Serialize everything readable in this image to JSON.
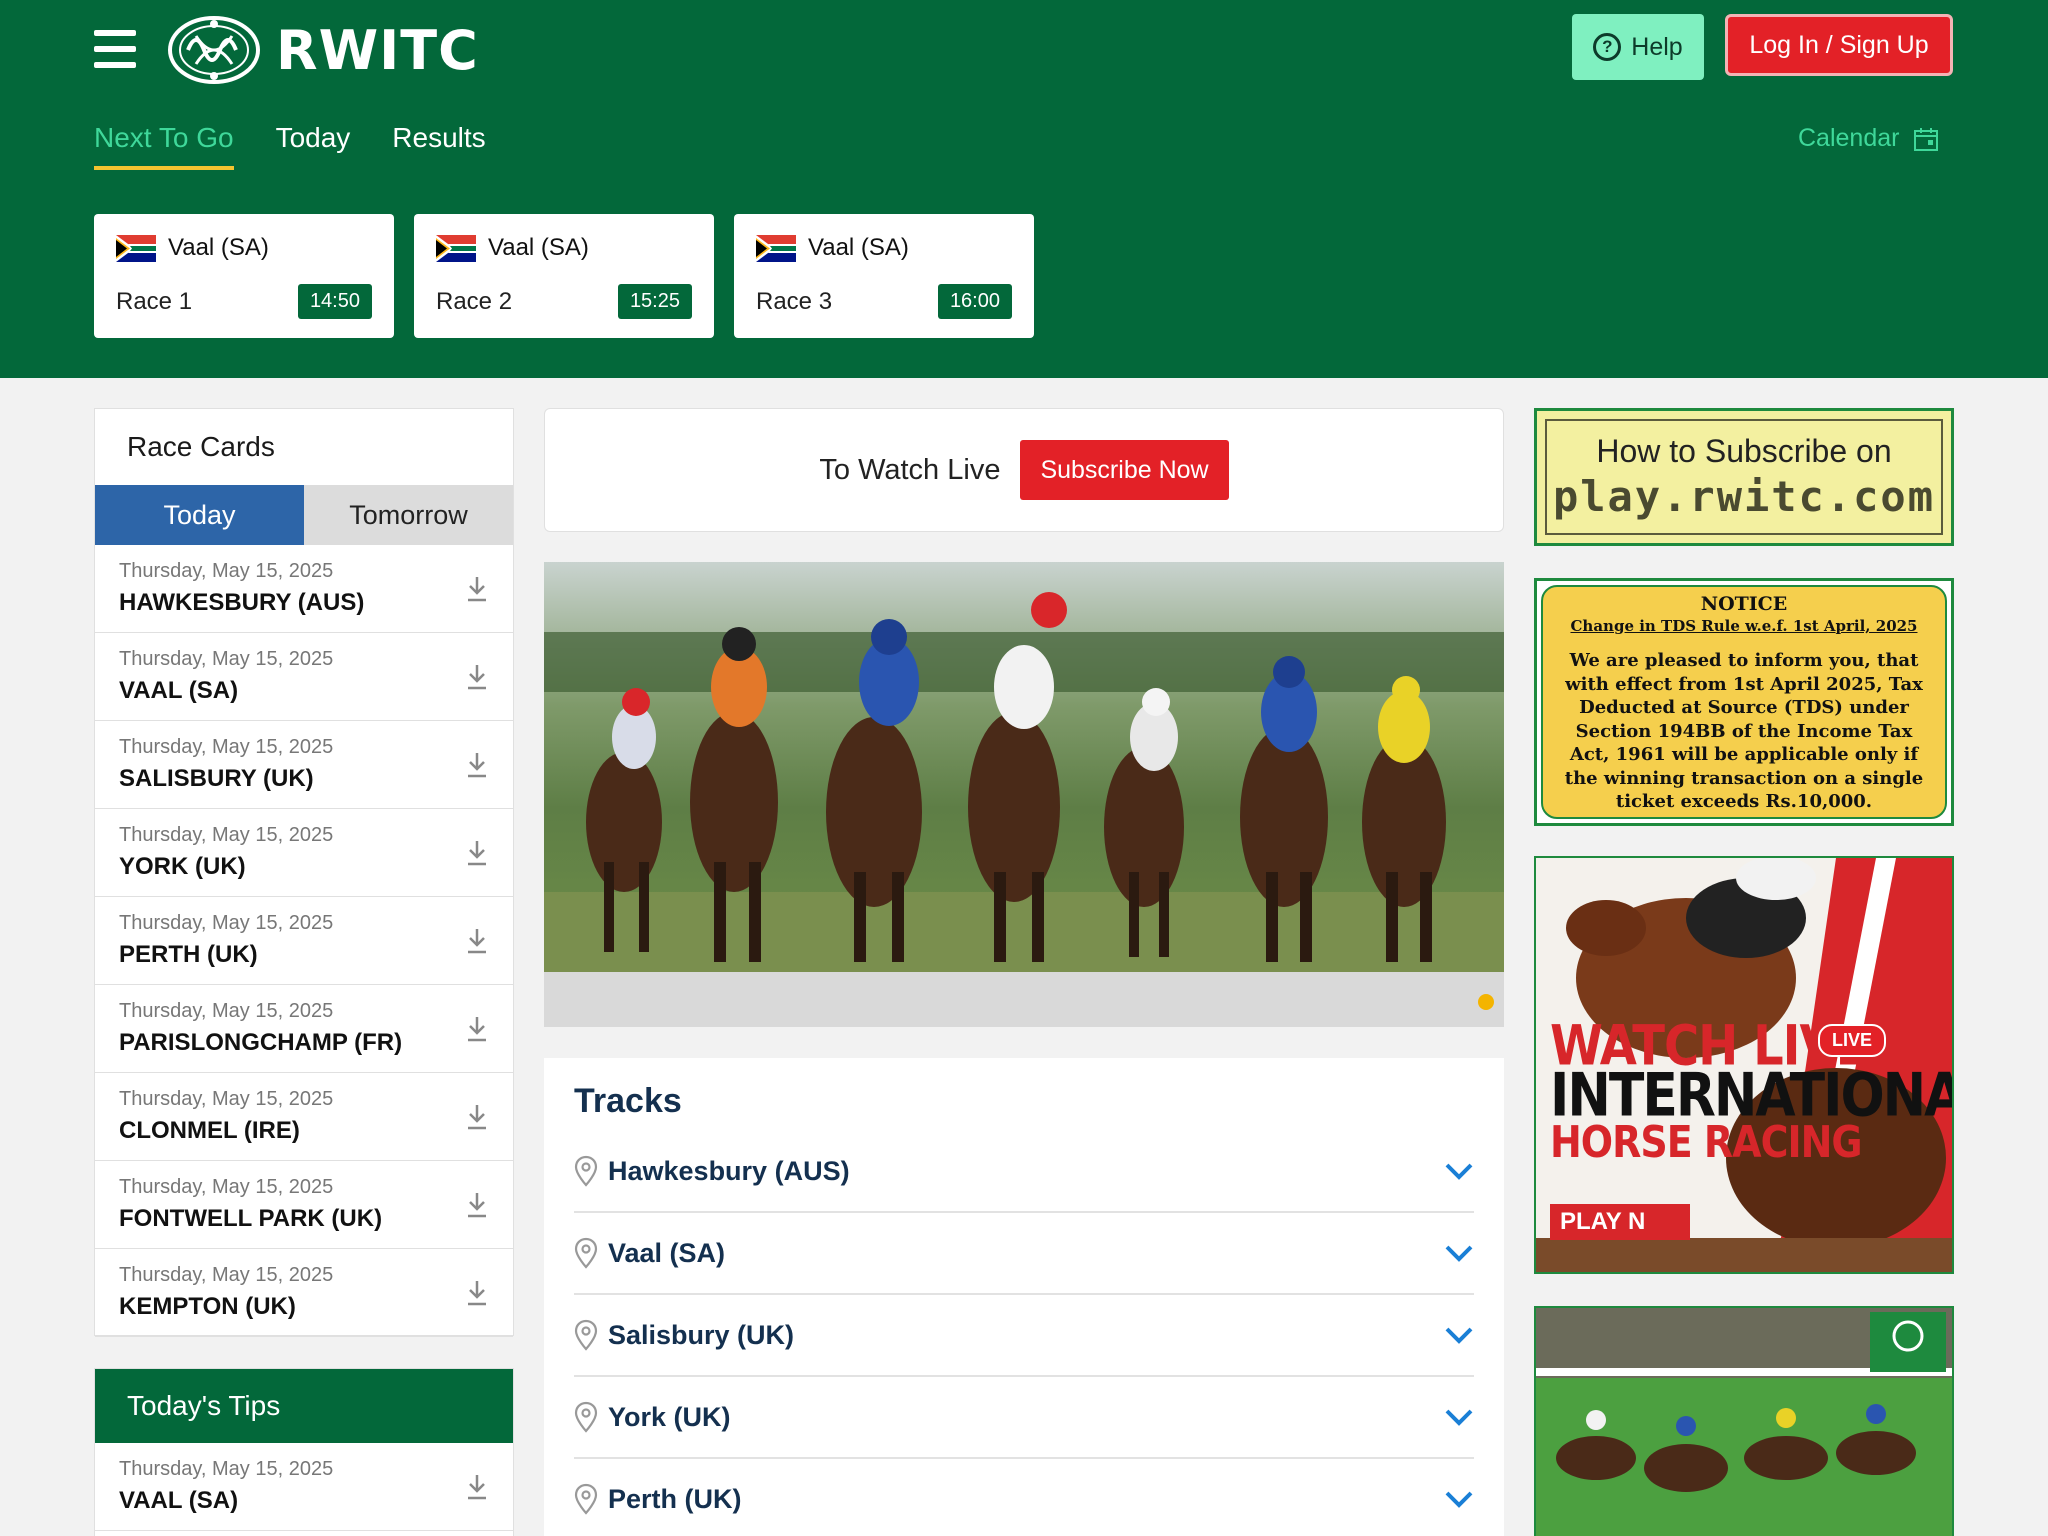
{
  "brand": {
    "name": "RWITC"
  },
  "header": {
    "help_label": "Help",
    "login_label": "Log In / Sign Up",
    "calendar_label": "Calendar"
  },
  "nav": {
    "items": [
      "Next To Go",
      "Today",
      "Results"
    ],
    "active": "Next To Go"
  },
  "next_races": [
    {
      "venue": "Vaal (SA)",
      "race": "Race 1",
      "time": "14:50"
    },
    {
      "venue": "Vaal (SA)",
      "race": "Race 2",
      "time": "15:25"
    },
    {
      "venue": "Vaal (SA)",
      "race": "Race 3",
      "time": "16:00"
    }
  ],
  "race_cards": {
    "title": "Race Cards",
    "tabs": [
      "Today",
      "Tomorrow"
    ],
    "active_tab": "Today",
    "rows": [
      {
        "date": "Thursday, May 15, 2025",
        "venue": "HAWKESBURY (AUS)"
      },
      {
        "date": "Thursday, May 15, 2025",
        "venue": "VAAL (SA)"
      },
      {
        "date": "Thursday, May 15, 2025",
        "venue": "SALISBURY (UK)"
      },
      {
        "date": "Thursday, May 15, 2025",
        "venue": "YORK (UK)"
      },
      {
        "date": "Thursday, May 15, 2025",
        "venue": "PERTH (UK)"
      },
      {
        "date": "Thursday, May 15, 2025",
        "venue": "PARISLONGCHAMP (FR)"
      },
      {
        "date": "Thursday, May 15, 2025",
        "venue": "CLONMEL (IRE)"
      },
      {
        "date": "Thursday, May 15, 2025",
        "venue": "FONTWELL PARK (UK)"
      },
      {
        "date": "Thursday, May 15, 2025",
        "venue": "KEMPTON (UK)"
      }
    ]
  },
  "tips": {
    "title": "Today's Tips",
    "rows": [
      {
        "date": "Thursday, May 15, 2025",
        "venue": "VAAL (SA)"
      }
    ]
  },
  "watch_live": {
    "text": "To Watch Live",
    "button": "Subscribe Now"
  },
  "carousel": {
    "active_slide": 1,
    "dot_color": "#f4b400"
  },
  "tracks": {
    "title": "Tracks",
    "items": [
      "Hawkesbury (AUS)",
      "Vaal (SA)",
      "Salisbury (UK)",
      "York (UK)",
      "Perth (UK)"
    ]
  },
  "ads": {
    "subscribe": {
      "line1": "How to Subscribe on",
      "line2": "play.rwitc.com"
    },
    "notice": {
      "title": "NOTICE",
      "subtitle": "Change in TDS Rule w.e.f. 1st April, 2025",
      "body": "We are pleased to inform you, that with effect from 1st April 2025, Tax Deducted at Source (TDS) under Section 194BB of the Income Tax Act, 1961 will be applicable only if the winning transaction on a single ticket exceeds Rs.10,000."
    },
    "watch": {
      "line1": "WATCH LIVE",
      "line2": "INTERNATIONAL",
      "line3": "HORSE RACING",
      "badge": "LIVE",
      "play": "PLAY N"
    }
  },
  "colors": {
    "header_green": "#03683a",
    "accent_mint": "#3fd89a",
    "active_underline": "#f4c430",
    "brand_red": "#e32127",
    "tab_blue": "#2d65a8",
    "track_text": "#14304f",
    "chevron_blue": "#1a7fd6"
  },
  "icons": [
    "menu-icon",
    "logo-emblem",
    "help-icon",
    "calendar-icon",
    "sa-flag-icon",
    "download-icon",
    "location-pin-icon",
    "chevron-down-icon"
  ]
}
